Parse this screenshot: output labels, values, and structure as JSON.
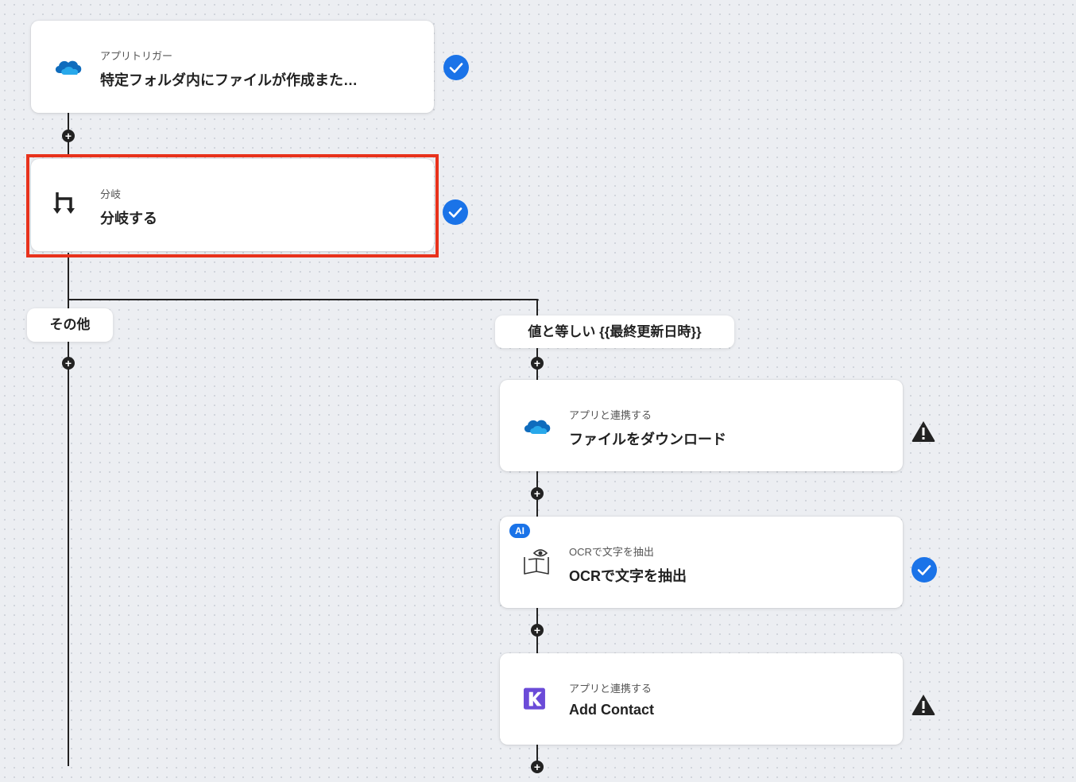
{
  "nodes": {
    "trigger": {
      "sub": "アプリトリガー",
      "title": "特定フォルダ内にファイルが作成また…",
      "icon": "onedrive-icon",
      "status": "check"
    },
    "branch": {
      "sub": "分岐",
      "title": "分岐する",
      "icon": "branch-icon",
      "status": "check"
    },
    "download": {
      "sub": "アプリと連携する",
      "title": "ファイルをダウンロード",
      "icon": "onedrive-icon",
      "status": "warning"
    },
    "ocr": {
      "badge": "AI",
      "sub": "OCRで文字を抽出",
      "title": "OCRで文字を抽出",
      "icon": "ocr-book-icon",
      "status": "check"
    },
    "contact": {
      "sub": "アプリと連携する",
      "title": "Add Contact",
      "icon": "kintone-k-icon",
      "status": "warning"
    }
  },
  "branches": {
    "other": "その他",
    "condition": "値と等しい {{最終更新日時}}"
  },
  "colors": {
    "accent": "#1a73e8",
    "highlight": "#e8321c",
    "brand_purple": "#6b4bd8"
  }
}
